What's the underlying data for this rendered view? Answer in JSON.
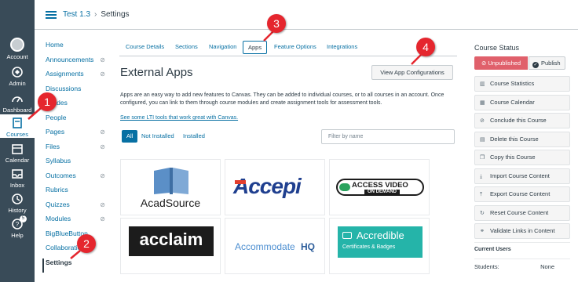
{
  "global_nav": {
    "account": "Account",
    "admin": "Admin",
    "dashboard": "Dashboard",
    "courses": "Courses",
    "calendar": "Calendar",
    "inbox": "Inbox",
    "history": "History",
    "help": "Help",
    "help_badge": "5"
  },
  "breadcrumb": {
    "course": "Test 1.3",
    "separator": "›",
    "page": "Settings"
  },
  "course_nav": {
    "items": [
      {
        "label": "Home"
      },
      {
        "label": "Announcements"
      },
      {
        "label": "Assignments"
      },
      {
        "label": "Discussions"
      },
      {
        "label": "Grades"
      },
      {
        "label": "People"
      },
      {
        "label": "Pages"
      },
      {
        "label": "Files"
      },
      {
        "label": "Syllabus"
      },
      {
        "label": "Outcomes"
      },
      {
        "label": "Rubrics"
      },
      {
        "label": "Quizzes"
      },
      {
        "label": "Modules"
      },
      {
        "label": "BigBlueButton"
      },
      {
        "label": "Collaborations"
      },
      {
        "label": "Settings"
      }
    ]
  },
  "tabs": [
    "Course Details",
    "Sections",
    "Navigation",
    "Apps",
    "Feature Options",
    "Integrations"
  ],
  "main": {
    "title": "External Apps",
    "config_button": "View App Configurations",
    "description": "Apps are an easy way to add new features to Canvas. They can be added to individual courses, or to all courses in an account. Once configured, you can link to them through course modules and create assignment tools for assessment tools.",
    "lti_link": "See some LTI tools that work great with Canvas.",
    "filters": [
      "All",
      "Not Installed",
      "Installed"
    ],
    "filter_placeholder": "Filter by name"
  },
  "apps": [
    {
      "name": "AcadSource"
    },
    {
      "name": "Accepi"
    },
    {
      "name": "ACCESS VIDEO",
      "sub": "ON DEMAND"
    },
    {
      "name": "acclaim"
    },
    {
      "name": "Accommodate",
      "suffix": "HQ"
    },
    {
      "name": "Accredible",
      "sub": "Certificates & Badges"
    }
  ],
  "sidebar": {
    "title": "Course Status",
    "unpublished": "Unpublished",
    "publish": "Publish",
    "actions": [
      "Course Statistics",
      "Course Calendar",
      "Conclude this Course",
      "Delete this Course",
      "Copy this Course",
      "Import Course Content",
      "Export Course Content",
      "Reset Course Content",
      "Validate Links in Content"
    ],
    "current_users": "Current Users",
    "students_label": "Students:",
    "students_value": "None"
  },
  "callouts": [
    "1",
    "2",
    "3",
    "4"
  ],
  "colors": {
    "link": "#0770a3",
    "nav": "#394b58",
    "callout": "#e5262e",
    "unpublished": "#e0606b"
  }
}
